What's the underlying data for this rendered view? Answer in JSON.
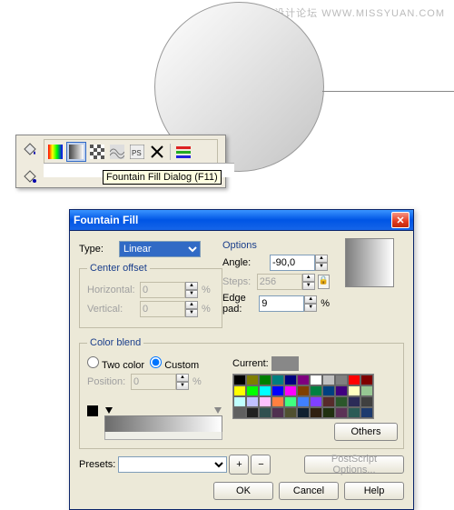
{
  "watermark": {
    "cn": "思缘设计论坛",
    "en": "WWW.MISSYUAN.COM"
  },
  "toolbar": {
    "icons": [
      "color-fill-icon",
      "fountain-fill-icon",
      "pattern-fill-icon",
      "texture-fill-icon",
      "postscript-fill-icon",
      "no-fill-icon",
      "edit-fill-icon"
    ],
    "tooltip": "Fountain Fill Dialog (F11)"
  },
  "dialog": {
    "title": "Fountain Fill",
    "type_label": "Type:",
    "type_value": "Linear",
    "center_offset": {
      "legend": "Center offset",
      "h_label": "Horizontal:",
      "h_val": "0",
      "v_label": "Vertical:",
      "v_val": "0",
      "pct": "%"
    },
    "options": {
      "legend": "Options",
      "angle_label": "Angle:",
      "angle_val": "-90,0",
      "steps_label": "Steps:",
      "steps_val": "256",
      "edge_label": "Edge pad:",
      "edge_val": "9",
      "pct": "%"
    },
    "color_blend": {
      "legend": "Color blend",
      "two": "Two color",
      "custom": "Custom",
      "position_label": "Position:",
      "position_val": "0",
      "pct": "%",
      "current_label": "Current:",
      "others": "Others"
    },
    "presets": {
      "label": "Presets:",
      "postscript": "PostScript Options..."
    },
    "buttons": {
      "ok": "OK",
      "cancel": "Cancel",
      "help": "Help"
    },
    "palette_colors": [
      "#000",
      "#7f7f00",
      "#007f00",
      "#007f7f",
      "#00007f",
      "#7f007f",
      "#fff",
      "#c0c0c0",
      "#808080",
      "#ff0000",
      "#7f0000",
      "#ffff00",
      "#00ff00",
      "#00ffff",
      "#0000ff",
      "#ff00ff",
      "#804000",
      "#008040",
      "#004080",
      "#400080",
      "#ffffc0",
      "#97c793",
      "#c0ffff",
      "#c0c0ff",
      "#ffc0ff",
      "#ff8040",
      "#40ff80",
      "#4080ff",
      "#8040ff",
      "#572b2b",
      "#2b572b",
      "#2b2b57",
      "#404040",
      "#606060",
      "#202020",
      "#305050",
      "#503050",
      "#505030",
      "#102030",
      "#302010",
      "#203010",
      "#5b3256",
      "#2a5b56",
      "#1d3a6e"
    ]
  }
}
